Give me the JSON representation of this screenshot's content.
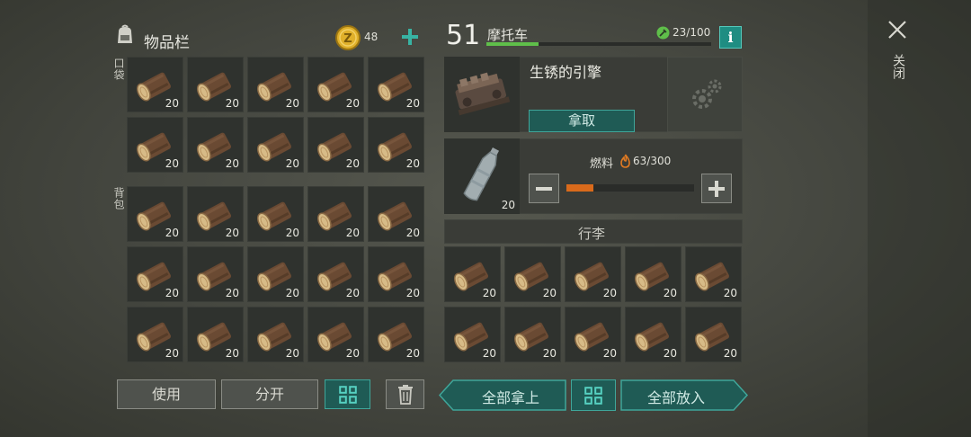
{
  "inventory": {
    "title": "物品栏",
    "coins": "48",
    "pocket_label": "口袋",
    "backpack_label": "背包",
    "pocket_items": [
      "20",
      "20",
      "20",
      "20",
      "20",
      "20",
      "20",
      "20",
      "20",
      "20"
    ],
    "backpack_items": [
      "20",
      "20",
      "20",
      "20",
      "20",
      "20",
      "20",
      "20",
      "20",
      "20",
      "20",
      "20",
      "20",
      "20",
      "20"
    ]
  },
  "vehicle": {
    "level": "51",
    "name": "摩托车",
    "durability": "23/100",
    "durability_fraction": 0.23,
    "engine_name": "生锈的引擎",
    "take_button": "拿取",
    "fuel_label": "燃料",
    "fuel_value": "63/300",
    "fuel_fraction": 0.21,
    "bottle_qty": "20",
    "luggage_title": "行李",
    "luggage_items": [
      "20",
      "20",
      "20",
      "20",
      "20",
      "20",
      "20",
      "20",
      "20",
      "20"
    ]
  },
  "actions": {
    "use": "使用",
    "split": "分开",
    "take_all": "全部拿上",
    "put_all": "全部放入"
  },
  "close_label": "关闭",
  "colors": {
    "accent_teal": "#2fa89b",
    "fuel_orange": "#d96a1b",
    "durability_green": "#5fbf4a",
    "coin_gold": "#e0b02a"
  }
}
